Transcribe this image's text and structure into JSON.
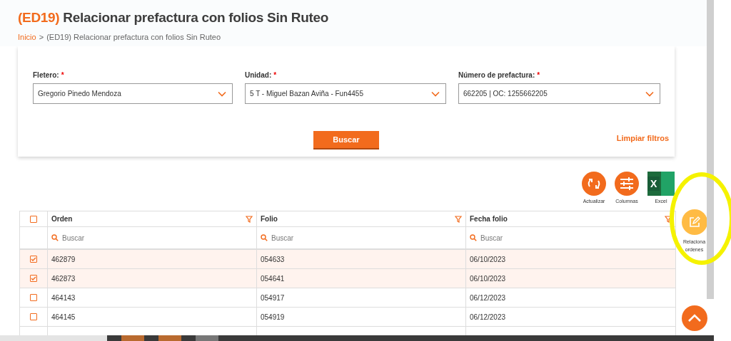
{
  "header": {
    "code": "(ED19)",
    "title": "Relacionar prefactura con folios Sin Ruteo",
    "breadcrumb": [
      {
        "label": "Inicio",
        "kind": "link"
      },
      {
        "label": "(ED19) Relacionar prefactura con folios Sin Ruteo",
        "kind": "current"
      }
    ],
    "breadcrumb_separator": ">"
  },
  "required_mark": "*",
  "filters": [
    {
      "label": "Fletero:",
      "required": true,
      "value": "Gregorio Pinedo Mendoza"
    },
    {
      "label": "Unidad:",
      "required": true,
      "value": "5 T - Miguel  Bazan Aviña - Fun4455"
    },
    {
      "label": "Número de prefactura:",
      "required": true,
      "value": "662205 | OC: 1255662205"
    }
  ],
  "search_button": "Buscar",
  "clear_filters": "Limpiar filtros",
  "toolbar": [
    {
      "kind": "refresh",
      "label": "Actualizar"
    },
    {
      "kind": "columns",
      "label": "Columnas"
    },
    {
      "kind": "excel",
      "label": "Excel",
      "icon_letter": "X"
    }
  ],
  "table": {
    "all_selected": false,
    "columns": [
      {
        "label": "Orden",
        "filter_placeholder": "Buscar"
      },
      {
        "label": "Folio",
        "filter_placeholder": "Buscar"
      },
      {
        "label": "Fecha folio",
        "filter_placeholder": "Buscar"
      }
    ],
    "rows": [
      {
        "selected": true,
        "cells": [
          "462879",
          "054633",
          "06/10/2023"
        ]
      },
      {
        "selected": true,
        "cells": [
          "462873",
          "054641",
          "06/10/2023"
        ]
      },
      {
        "selected": false,
        "cells": [
          "464143",
          "054917",
          "06/12/2023"
        ]
      },
      {
        "selected": false,
        "cells": [
          "464145",
          "054919",
          "06/12/2023"
        ]
      }
    ]
  },
  "side_action": {
    "label": "Relaciona ordenes",
    "highlighted": true
  }
}
